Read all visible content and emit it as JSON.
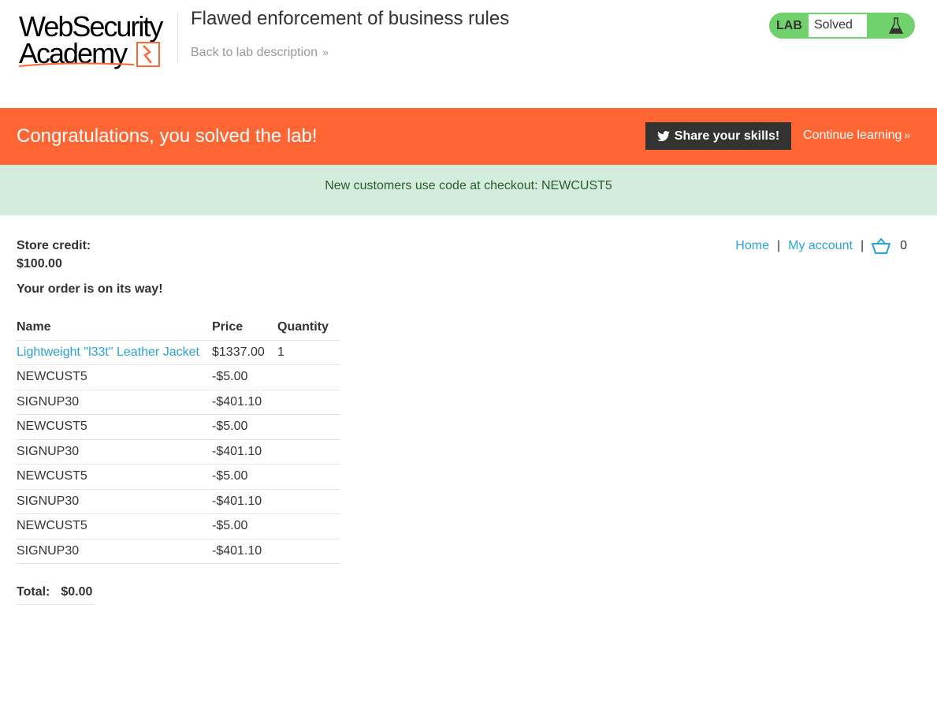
{
  "header": {
    "logo_line1": "WebSecurity",
    "logo_line2": "Academy",
    "lab_title": "Flawed enforcement of business rules",
    "back_link": "Back to lab description",
    "lab_badge": "LAB",
    "lab_status": "Solved"
  },
  "banner": {
    "message": "Congratulations, you solved the lab!",
    "share_label": "Share your skills!",
    "continue_label": "Continue learning"
  },
  "notice": {
    "text": "New customers use code at checkout: NEWCUST5"
  },
  "account": {
    "credit_label": "Store credit:",
    "credit_value": "$100.00",
    "order_message": "Your order is on its way!"
  },
  "nav": {
    "home": "Home",
    "separator": "|",
    "my_account": "My account",
    "cart_count": "0"
  },
  "order": {
    "headers": [
      "Name",
      "Price",
      "Quantity"
    ],
    "rows": [
      {
        "name": "Lightweight \"l33t\" Leather Jacket",
        "price": "$1337.00",
        "quantity": "1"
      },
      {
        "name": "NEWCUST5",
        "price": "-$5.00",
        "quantity": ""
      },
      {
        "name": "SIGNUP30",
        "price": "-$401.10",
        "quantity": ""
      },
      {
        "name": "NEWCUST5",
        "price": "-$5.00",
        "quantity": ""
      },
      {
        "name": "SIGNUP30",
        "price": "-$401.10",
        "quantity": ""
      },
      {
        "name": "NEWCUST5",
        "price": "-$5.00",
        "quantity": ""
      },
      {
        "name": "SIGNUP30",
        "price": "-$401.10",
        "quantity": ""
      },
      {
        "name": "NEWCUST5",
        "price": "-$5.00",
        "quantity": ""
      },
      {
        "name": "SIGNUP30",
        "price": "-$401.10",
        "quantity": ""
      }
    ],
    "total_label": "Total:",
    "total_value": "$0.00"
  },
  "colors": {
    "brand_orange": "#ff6633",
    "lab_green": "#70d16d",
    "link_blue": "#29a3d9",
    "notice_bg": "#d4ecdc"
  },
  "icons": [
    "bolt-icon",
    "chevron-double-right-icon",
    "flask-icon",
    "twitter-icon",
    "cart-icon"
  ]
}
